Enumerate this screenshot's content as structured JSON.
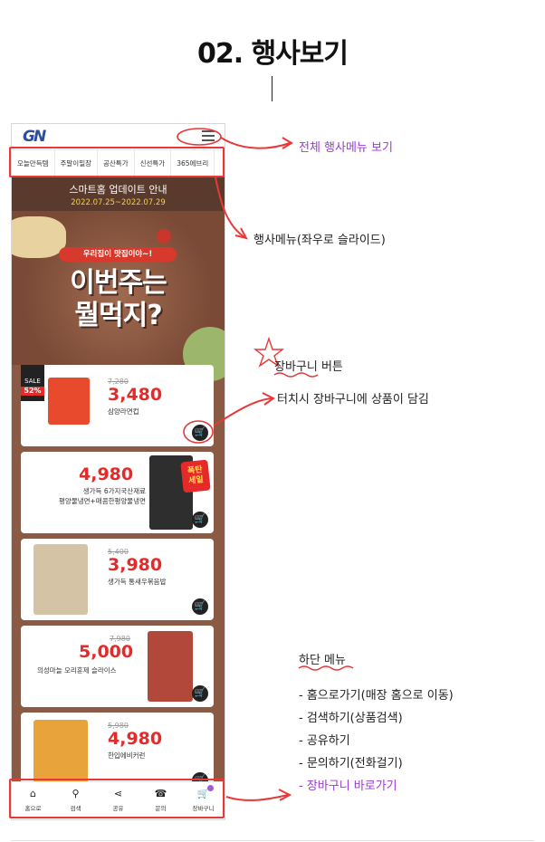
{
  "page": {
    "title": "02. 행사보기"
  },
  "app": {
    "logo": "GN",
    "event_tabs": [
      "오늘만득템",
      "주말이밀장",
      "공산특가",
      "신선특가",
      "365에브리"
    ],
    "banner": {
      "heading": "스마트홈 업데이트 안내",
      "date_range": "2022.07.25~2022.07.29"
    },
    "hero": {
      "pill": "우리집이 맛집이야~!",
      "title_line1": "이번주는",
      "title_line2": "뭘먹지?"
    },
    "products": [
      {
        "badge_label": "SALE",
        "badge_percent": "52%",
        "old_price": "7,280",
        "price": "3,480",
        "name": "삼양라면컵"
      },
      {
        "old_price": "",
        "price": "4,980",
        "name_line1": "생가득 6가지국산재료",
        "name_line2": "평양물냉면+매콤한평양물냉면",
        "burst": "폭탄\n세일"
      },
      {
        "old_price": "5,400",
        "price": "3,980",
        "name": "생가득 통새우볶음밥"
      },
      {
        "old_price": "7,980",
        "price": "5,000",
        "name": "의성마늘 오리훈제 슬라이스"
      },
      {
        "old_price": "5,980",
        "price": "4,980",
        "name": "한입에비커런"
      }
    ],
    "bottom_nav": [
      {
        "label": "홈으로",
        "icon": "home-icon"
      },
      {
        "label": "검색",
        "icon": "search-icon"
      },
      {
        "label": "공유",
        "icon": "share-icon"
      },
      {
        "label": "문의",
        "icon": "phone-icon"
      },
      {
        "label": "장바구니",
        "icon": "cart-icon"
      }
    ]
  },
  "annotations": {
    "full_menu": "전체 행사메뉴 보기",
    "event_menu": "행사메뉴(좌우로 슬라이드)",
    "cart_button_title": "장바구니 버튼",
    "cart_button_desc": "터치시 장바구니에 상품이 담김",
    "bottom_menu_title": "하단 메뉴",
    "bottom_menu_items": [
      "- 홈으로가기(매장 홈으로 이동)",
      "- 검색하기(상품검색)",
      "- 공유하기",
      "- 문의하기(전화걸기)",
      "- 장바구니 바로가기"
    ]
  },
  "colors": {
    "accent_red": "#e83838",
    "annotation_purple": "#9a3ad6",
    "price_red": "#e62a2a",
    "board_brown": "#8a5a44"
  }
}
